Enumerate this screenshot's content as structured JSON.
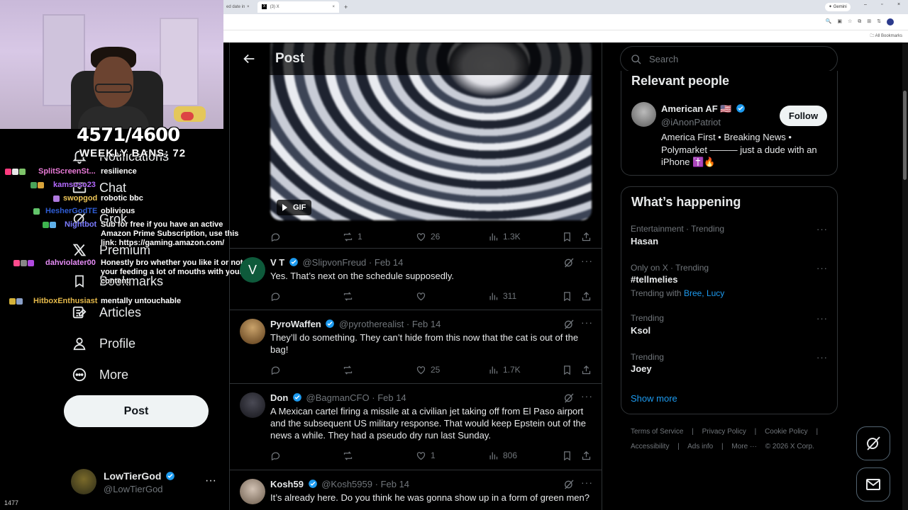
{
  "browser": {
    "prev_tab_label": "ed date in",
    "active_tab_label": "(3) X",
    "active_tab_favicon": "X",
    "new_tab": "+",
    "gemini_label": "Gemini",
    "all_bookmarks": "All Bookmarks",
    "tab_close": "×",
    "window_controls": [
      "–",
      "▫",
      "×"
    ]
  },
  "stream": {
    "bans_count": "4571/4600",
    "bans_label": "WEEKLY BANS: 72",
    "viewer_count": "1477",
    "chat": [
      {
        "user": "SplitScreenSt...",
        "color": "#e87ad6",
        "text": "resilience",
        "badges": [
          "#ff3b7f",
          "#e8e8e8",
          "#7ec46a"
        ]
      },
      {
        "user": "kamsoso23",
        "color": "#b46aff",
        "text": "",
        "badges": [
          "#4aa35a",
          "#d9a43a"
        ]
      },
      {
        "user": "swopgod",
        "color": "#f0c85a",
        "text": "robotic bbc",
        "badges": [
          "#b07adf"
        ]
      },
      {
        "user": "HesherGodTE",
        "color": "#2f5dd4",
        "text": "oblivious",
        "badges": [
          "#62c46a"
        ]
      },
      {
        "user": "Nightbot",
        "color": "#7c7cff",
        "text": "Sub for free if you have an active Amazon Prime Subscription, use this link: https://gaming.amazon.com/",
        "badges": [
          "#3eb44f",
          "#5fb0e8"
        ]
      },
      {
        "user": "dahviolater00",
        "color": "#e58cf5",
        "text": "Honestly bro whether you like it or not, your feeding a lot of mouths with your content",
        "badges": [
          "#ff4b8d",
          "#888",
          "#b04adf"
        ]
      },
      {
        "user": "HitboxEnthusiast",
        "color": "#e5b94a",
        "text": "mentally untouchable",
        "badges": [
          "#d4b23a",
          "#8aa0c8"
        ]
      }
    ]
  },
  "nav": {
    "items": [
      {
        "label": "Notifications",
        "icon": "bell-icon"
      },
      {
        "label": "Chat",
        "icon": "mail-icon"
      },
      {
        "label": "Grok",
        "icon": "grok-icon"
      },
      {
        "label": "Premium",
        "icon": "x-logo-icon"
      },
      {
        "label": "Bookmarks",
        "icon": "bookmark-icon"
      },
      {
        "label": "Articles",
        "icon": "article-icon"
      },
      {
        "label": "Profile",
        "icon": "profile-icon"
      },
      {
        "label": "More",
        "icon": "more-circle-icon"
      }
    ],
    "post_button": "Post",
    "account": {
      "name": "LowTierGod",
      "handle": "@LowTierGod",
      "more": "···"
    }
  },
  "main": {
    "title": "Post",
    "gif_label": "GIF",
    "original_post_stats": {
      "reposts": "1",
      "likes": "26",
      "views": "1.3K"
    },
    "replies": [
      {
        "name": "V T",
        "handle": "@SlipvonFreud",
        "date": "Feb 14",
        "text": "Yes. That’s next on the schedule supposedly.",
        "replies": "",
        "reposts": "",
        "likes": "",
        "views": "311",
        "avatar_letter": "V",
        "verified": true
      },
      {
        "name": "PyroWaffen",
        "handle": "@pyrotherealist",
        "date": "Feb 14",
        "text": "They’ll do something. They can’t hide from this now that the cat is out of the bag!",
        "replies": "",
        "reposts": "",
        "likes": "25",
        "views": "1.7K",
        "verified": true
      },
      {
        "name": "Don",
        "handle": "@BagmanCFO",
        "date": "Feb 14",
        "text": "A Mexican cartel firing a missile at a civilian jet taking off from El Paso airport and the subsequent US military response. That would keep Epstein out of the news a while. They had a pseudo dry run last Sunday.",
        "replies": "",
        "reposts": "",
        "likes": "1",
        "views": "806",
        "verified": true
      },
      {
        "name": "Kosh59",
        "handle": "@Kosh5959",
        "date": "Feb 14",
        "text": "It’s already here. Do you think he was gonna show up in a form of green men?",
        "verified": true
      }
    ],
    "dot_separator": "·",
    "more": "···"
  },
  "sidebar": {
    "search_placeholder": "Search",
    "relevant_people": {
      "title": "Relevant people",
      "name": "American AF 🇺🇸",
      "handle": "@iAnonPatriot",
      "bio": "America First • Breaking News • Polymarket ——— just a dude with an iPhone ✝️🔥",
      "follow_label": "Follow"
    },
    "happening": {
      "title": "What’s happening",
      "trends": [
        {
          "meta": "Entertainment · Trending",
          "name": "Hasan",
          "with": ""
        },
        {
          "meta": "Only on X · Trending",
          "name": "#tellmelies",
          "with_prefix": "Trending with",
          "with": "Bree, Lucy"
        },
        {
          "meta": "Trending",
          "name": "Ksol",
          "with": ""
        },
        {
          "meta": "Trending",
          "name": "Joey",
          "with": ""
        }
      ],
      "show_more": "Show more",
      "more": "···"
    },
    "footer": {
      "row1": [
        "Terms of Service",
        "|",
        "Privacy Policy",
        "|",
        "Cookie Policy",
        "|"
      ],
      "row2": [
        "Accessibility",
        "|",
        "Ads info",
        "|",
        "More ···",
        "© 2026 X Corp."
      ]
    }
  }
}
